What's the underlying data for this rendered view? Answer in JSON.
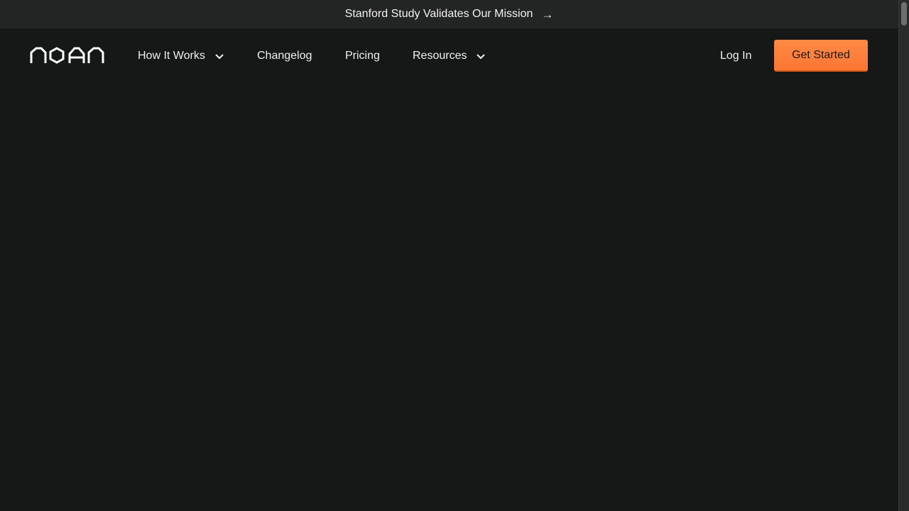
{
  "announcement": {
    "text": "Stanford Study Validates Our Mission",
    "arrow_icon": "arrow-right-icon"
  },
  "brand": {
    "logo_text": "noan",
    "accent_color": "#ff7f3d"
  },
  "nav": {
    "items": [
      {
        "label": "How It Works",
        "has_dropdown": true
      },
      {
        "label": "Changelog",
        "has_dropdown": false
      },
      {
        "label": "Pricing",
        "has_dropdown": false
      },
      {
        "label": "Resources",
        "has_dropdown": true
      }
    ],
    "login_label": "Log In",
    "cta_label": "Get Started"
  }
}
